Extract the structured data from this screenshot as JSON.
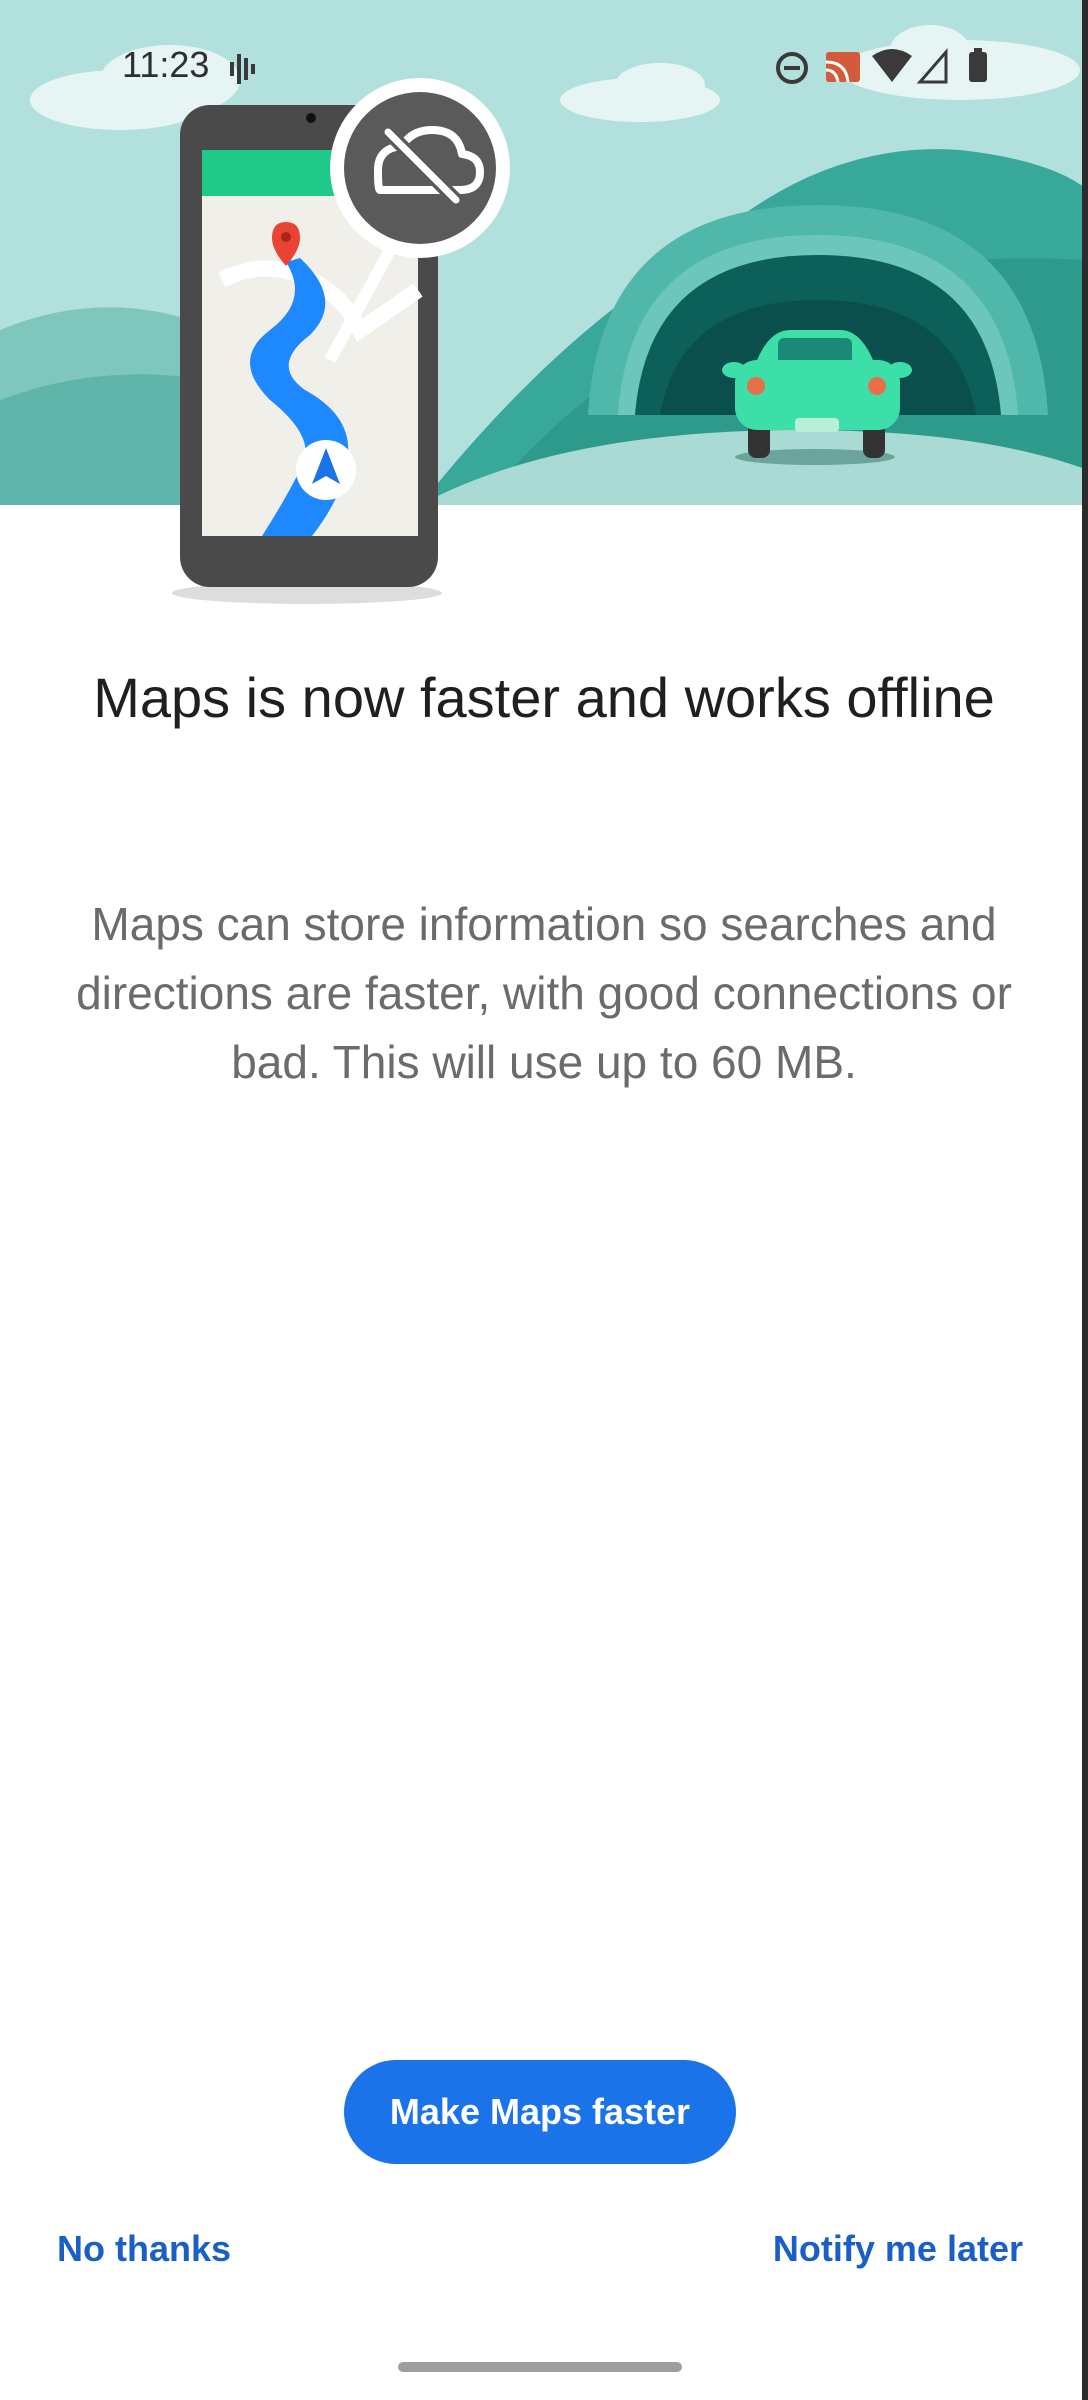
{
  "status_bar": {
    "time": "11:23",
    "icons": [
      "sound-wave-icon",
      "do-not-disturb-icon",
      "cast-icon",
      "wifi-icon",
      "cell-signal-icon",
      "battery-icon"
    ]
  },
  "hero": {
    "icons": [
      "phone-map-illustration",
      "offline-cloud-icon",
      "location-pin-icon",
      "navigation-arrow-icon",
      "tunnel-illustration",
      "car-illustration"
    ]
  },
  "content": {
    "title": "Maps is now faster and works offline",
    "body": "Maps can store information so searches and directions are faster, with good connections or bad. This will use up to 60 MB."
  },
  "actions": {
    "primary_label": "Make Maps faster",
    "decline_label": "No thanks",
    "later_label": "Notify me later"
  },
  "colors": {
    "sky": "#b2e0dc",
    "accent_blue": "#1a73e8",
    "map_green": "#1fc98a",
    "car_green": "#3ddfa8"
  }
}
